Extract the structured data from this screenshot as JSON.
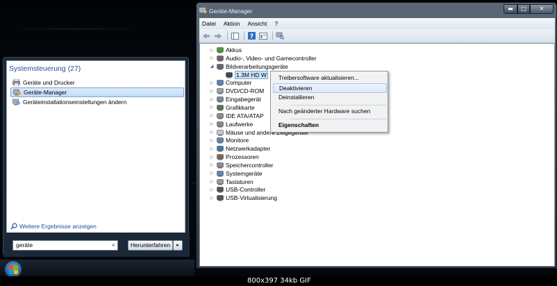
{
  "start_menu": {
    "header": "Systemsteuerung (27)",
    "items": [
      {
        "label": "Geräte und Drucker",
        "icon": "printer-icon"
      },
      {
        "label": "Geräte-Manager",
        "icon": "device-manager-icon",
        "selected": true
      },
      {
        "label": "Geräteinstallationseinstellungen ändern",
        "icon": "device-settings-icon"
      }
    ],
    "more_results": "Weitere Ergebnisse anzeigen",
    "search_value": "geräte",
    "search_clear": "×",
    "shutdown_label": "Herunterfahren",
    "shutdown_arrow": "▸"
  },
  "window": {
    "title": "Geräte-Manager",
    "controls": {
      "minimize": "▬",
      "maximize": "□",
      "close": "✕"
    },
    "menu": [
      "Datei",
      "Aktion",
      "Ansicht",
      "?"
    ],
    "tree": [
      {
        "label": "Akkus",
        "icon": "battery-icon",
        "expanded": false
      },
      {
        "label": "Audio-, Video- und Gamecontroller",
        "icon": "audio-icon",
        "expanded": false
      },
      {
        "label": "Bildverarbeitungsgeräte",
        "icon": "camera-icon",
        "expanded": true
      },
      {
        "label": "1.3M HD W",
        "icon": "webcam-icon",
        "child": true,
        "selected": true
      },
      {
        "label": "Computer",
        "icon": "computer-icon",
        "expanded": false
      },
      {
        "label": "DVD/CD-ROM",
        "icon": "dvd-icon",
        "expanded": false
      },
      {
        "label": "Eingabegerät",
        "icon": "input-device-icon",
        "expanded": false
      },
      {
        "label": "Grafikkarte",
        "icon": "display-adapter-icon",
        "expanded": false
      },
      {
        "label": "IDE ATA/ATAP",
        "icon": "ide-icon",
        "expanded": false
      },
      {
        "label": "Laufwerke",
        "icon": "drive-icon",
        "expanded": false
      },
      {
        "label": "Mäuse und andere Zeigegeräte",
        "icon": "mouse-icon",
        "expanded": false
      },
      {
        "label": "Monitore",
        "icon": "monitor-icon",
        "expanded": false
      },
      {
        "label": "Netzwerkadapter",
        "icon": "network-icon",
        "expanded": false
      },
      {
        "label": "Prozessoren",
        "icon": "processor-icon",
        "expanded": false
      },
      {
        "label": "Speichercontroller",
        "icon": "storage-icon",
        "expanded": false
      },
      {
        "label": "Systemgeräte",
        "icon": "system-icon",
        "expanded": false
      },
      {
        "label": "Tastaturen",
        "icon": "keyboard-icon",
        "expanded": false
      },
      {
        "label": "USB-Controller",
        "icon": "usb-icon",
        "expanded": false
      },
      {
        "label": "USB-Virtualisierung",
        "icon": "usb-icon",
        "expanded": false
      }
    ],
    "context_menu": [
      {
        "label": "Treibersoftware aktualisieren..."
      },
      {
        "label": "Deaktivieren",
        "hover": true
      },
      {
        "label": "Deinstallieren"
      },
      {
        "label": "Nach geänderter Hardware suchen"
      },
      {
        "label": "Eigenschaften",
        "bold": true
      }
    ]
  },
  "caption": "800x397  34kb  GIF",
  "colors": {
    "accent": "#1e4f95",
    "selection": "#c1dbfc"
  }
}
